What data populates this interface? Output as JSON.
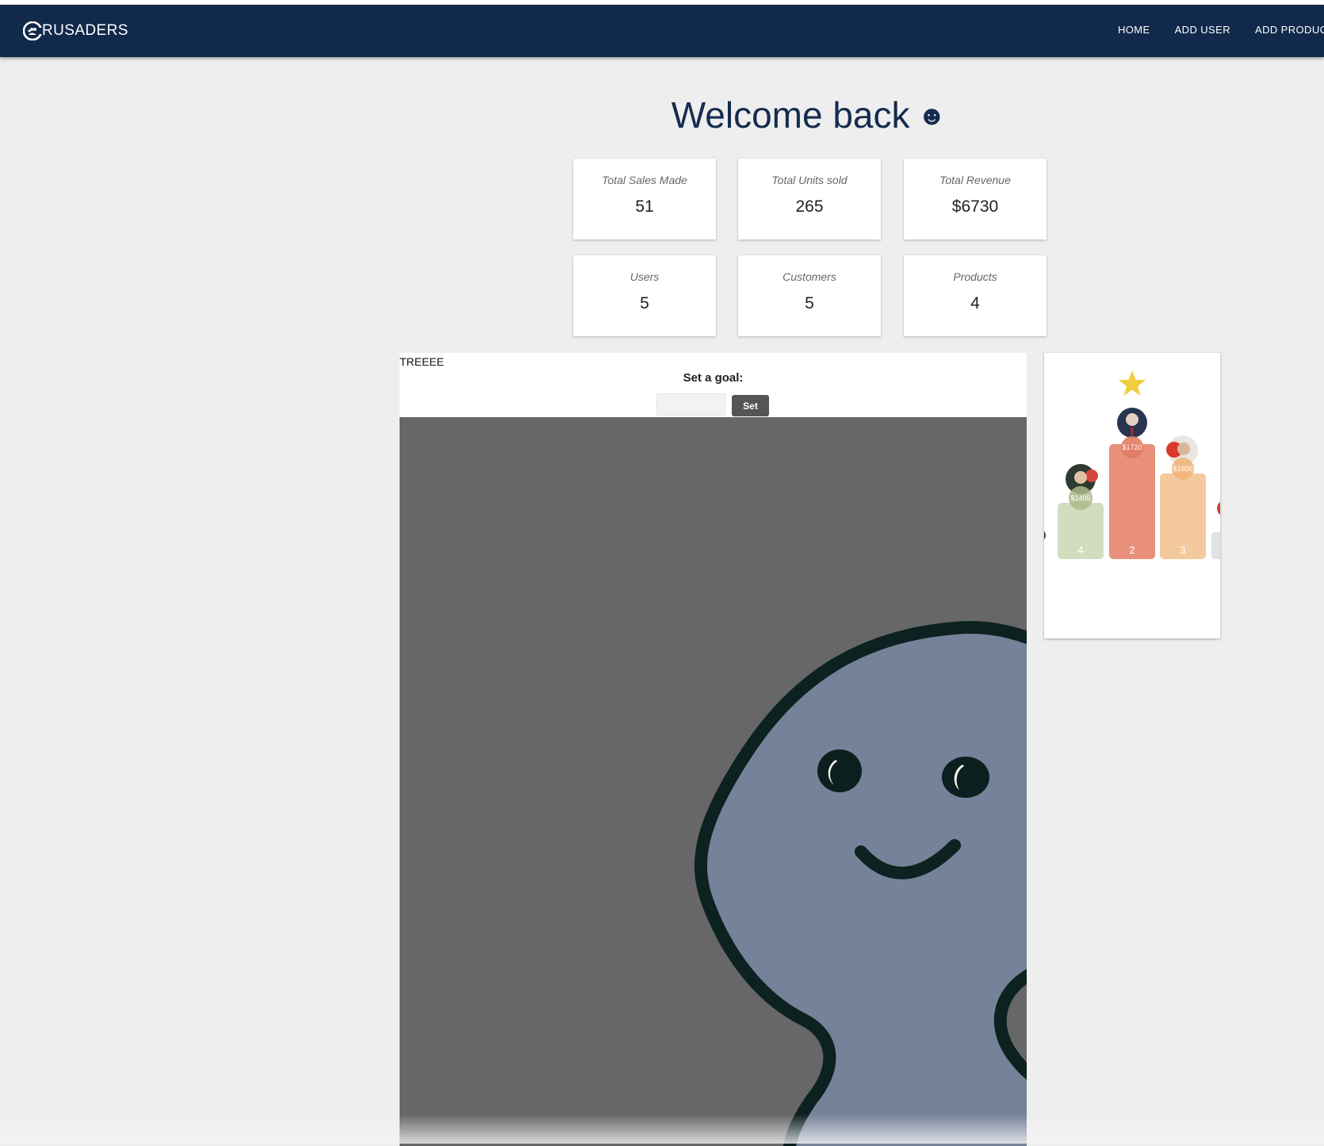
{
  "app": {
    "brand": "RUSADERS",
    "logo_icon": "crusaders-logo-icon"
  },
  "nav": {
    "items": [
      "HOME",
      "ADD USER",
      "ADD PRODUCT"
    ]
  },
  "header": {
    "title": "Welcome back",
    "title_icon": "☻"
  },
  "stats": {
    "sales": {
      "label": "Total Sales Made",
      "value": "51"
    },
    "units": {
      "label": "Total Units sold",
      "value": "265"
    },
    "revenue": {
      "label": "Total Revenue",
      "value": "$6730"
    },
    "users": {
      "label": "Users",
      "value": "5"
    },
    "customers": {
      "label": "Customers",
      "value": "5"
    },
    "products": {
      "label": "Products",
      "value": "4"
    }
  },
  "tree": {
    "title": "TREEEE",
    "goal_label": "Set a goal:",
    "goal_input_value": "",
    "set_button": "Set",
    "mascot_icon": "blob-mascot-icon"
  },
  "leaderboard": {
    "top_icon": "star-icon",
    "entries": [
      {
        "rank": "4",
        "amount": "$1495",
        "color": "#d4dcc0",
        "badge": "#a9b98a"
      },
      {
        "rank": "2",
        "amount": "$1720",
        "color": "#e8907a",
        "badge": "#e27a62"
      },
      {
        "rank": "3",
        "amount": "$1600",
        "color": "#f3c99d",
        "badge": "#efb27a"
      }
    ]
  }
}
